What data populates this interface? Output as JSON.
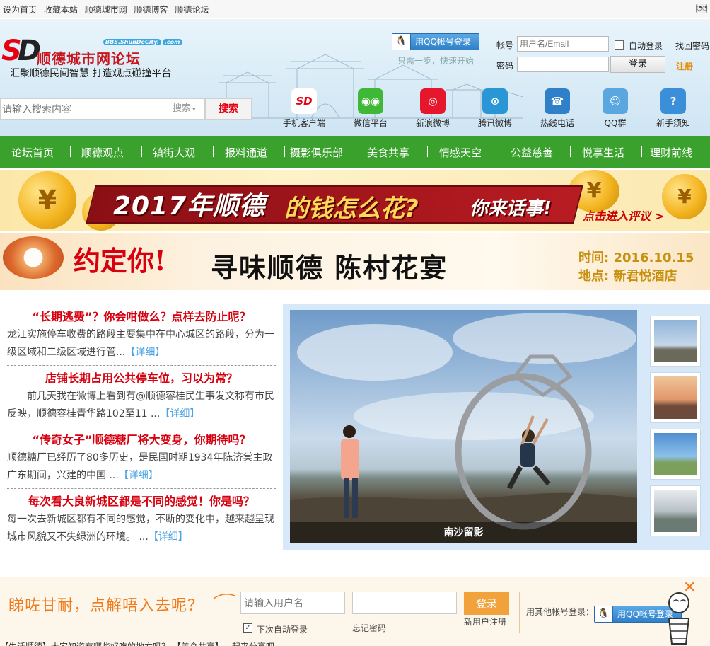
{
  "topbar": {
    "links": [
      "设为首页",
      "收藏本站",
      "顺德城市网",
      "顺德博客",
      "顺德论坛"
    ],
    "icon": "glasses-icon"
  },
  "header": {
    "logo_mark": "SD",
    "site_name": "顺德城市网论坛",
    "domain": "BBS.ShunDeCity.",
    "domain_suffix": ".com",
    "slogan": "汇聚顺德民间智慧  打造观点碰撞平台",
    "search": {
      "placeholder": "请输入搜索内容",
      "select": "搜索",
      "button": "搜索"
    },
    "qq_login": "用QQ帐号登录",
    "quick_start": "只需一步，快速开始",
    "account_label": "帐号",
    "account_placeholder": "用户名/Email",
    "auto_login": "自动登录",
    "find_password": "找回密码",
    "password_label": "密码",
    "login_button": "登录",
    "register": "注册"
  },
  "app_icons": [
    {
      "label": "手机客户端",
      "icon": "mobile-app-icon",
      "color": "#e60012",
      "glyph": "SD"
    },
    {
      "label": "微信平台",
      "icon": "wechat-icon",
      "color": "#3fb837",
      "glyph": "◉◉"
    },
    {
      "label": "新浪微博",
      "icon": "sina-weibo-icon",
      "color": "#e6162d",
      "glyph": "◎"
    },
    {
      "label": "腾讯微博",
      "icon": "tencent-weibo-icon",
      "color": "#2a96d6",
      "glyph": "⊙"
    },
    {
      "label": "热线电话",
      "icon": "hotline-icon",
      "color": "#2f7fc9",
      "glyph": "☎"
    },
    {
      "label": "QQ群",
      "icon": "qq-group-icon",
      "color": "#5aa7e0",
      "glyph": "☺"
    },
    {
      "label": "新手须知",
      "icon": "newbie-guide-icon",
      "color": "#3a8fd8",
      "glyph": "?"
    }
  ],
  "nav": [
    "论坛首页",
    "顺德观点",
    "镇街大观",
    "报料通道",
    "摄影俱乐部",
    "美食共享",
    "情感天空",
    "公益慈善",
    "悦享生活",
    "理财前线"
  ],
  "banner1": {
    "coin_glyph": "¥",
    "part1": "2017年顺德",
    "part2": "的钱怎么花?",
    "part3": "你来话事!",
    "cta": "点击进入评议 >"
  },
  "banner2": {
    "headline": "约定你!",
    "event": "寻味顺德 陈村花宴",
    "time_label": "时间:",
    "time_value": "2016.10.15",
    "place_label": "地点:",
    "place_value": "新君悦酒店"
  },
  "news": [
    {
      "title": "“长期逃费”？你会咁做么？点样去防止呢？",
      "desc": "龙江实施停车收费的路段主要集中在中心城区的路段，分为一级区域和二级区域进行管...",
      "more": "【详细】"
    },
    {
      "title": "店铺长期占用公共停车位，习以为常？",
      "desc": "　　前几天我在微博上看到有@顺德容桂民生事发文称有市民反映，顺德容桂青华路102至11 ...",
      "more": "【详细】"
    },
    {
      "title": "“传奇女子”顺德糖厂将大变身，你期待吗？",
      "desc": "顺德糖厂已经历了80多历史，是民国时期1934年陈济棠主政广东期间，兴建的中国 ...",
      "more": "【详细】"
    },
    {
      "title": "每次看大良新城区都是不同的感觉！你是吗？",
      "desc": "每一次去新城区都有不同的感觉，不断的变化中，越来越呈现城市风貌又不失绿洲的环境。 ...",
      "more": "【详细】"
    }
  ],
  "slider": {
    "caption": "南沙留影"
  },
  "bottom": {
    "question": "睇咗甘耐，点解唔入去呢？",
    "username_placeholder": "请输入用户名",
    "auto_login": "下次自动登录",
    "forgot": "忘记密码",
    "login": "登录",
    "new_user": "新用户注册",
    "other_login": "用其他帐号登录：",
    "qq_login": "用QQ帐号登录"
  },
  "peek_text": "【生活顺德】大家知道有哪些好吃的地方吗？  【美食共享】一起来分享吧"
}
